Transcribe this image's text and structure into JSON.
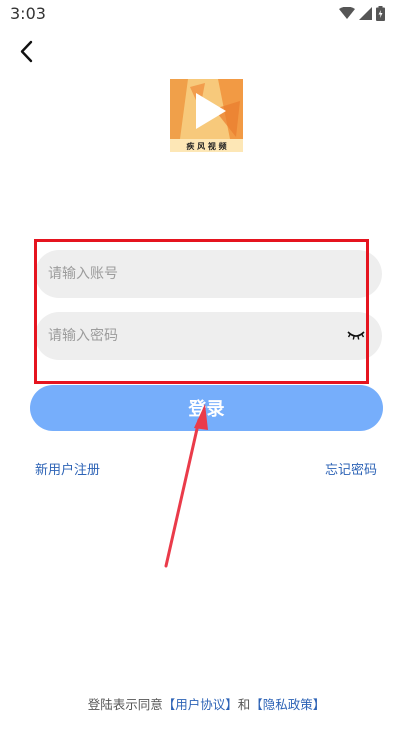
{
  "status_bar": {
    "time": "3:03"
  },
  "logo": {
    "caption": "疾 风 视 频"
  },
  "form": {
    "account_placeholder": "请输入账号",
    "password_placeholder": "请输入密码"
  },
  "login_button": {
    "label": "登录"
  },
  "links": {
    "register": "新用户注册",
    "forgot_password": "忘记密码"
  },
  "agreement": {
    "prefix": "登陆表示同意",
    "user_agreement": "【用户协议】",
    "and": "和",
    "privacy_policy": "【隐私政策】"
  },
  "colors": {
    "accent": "#76aefb",
    "link": "#2d63b6",
    "highlight": "#e5141f",
    "input_bg": "#eeeeee"
  }
}
